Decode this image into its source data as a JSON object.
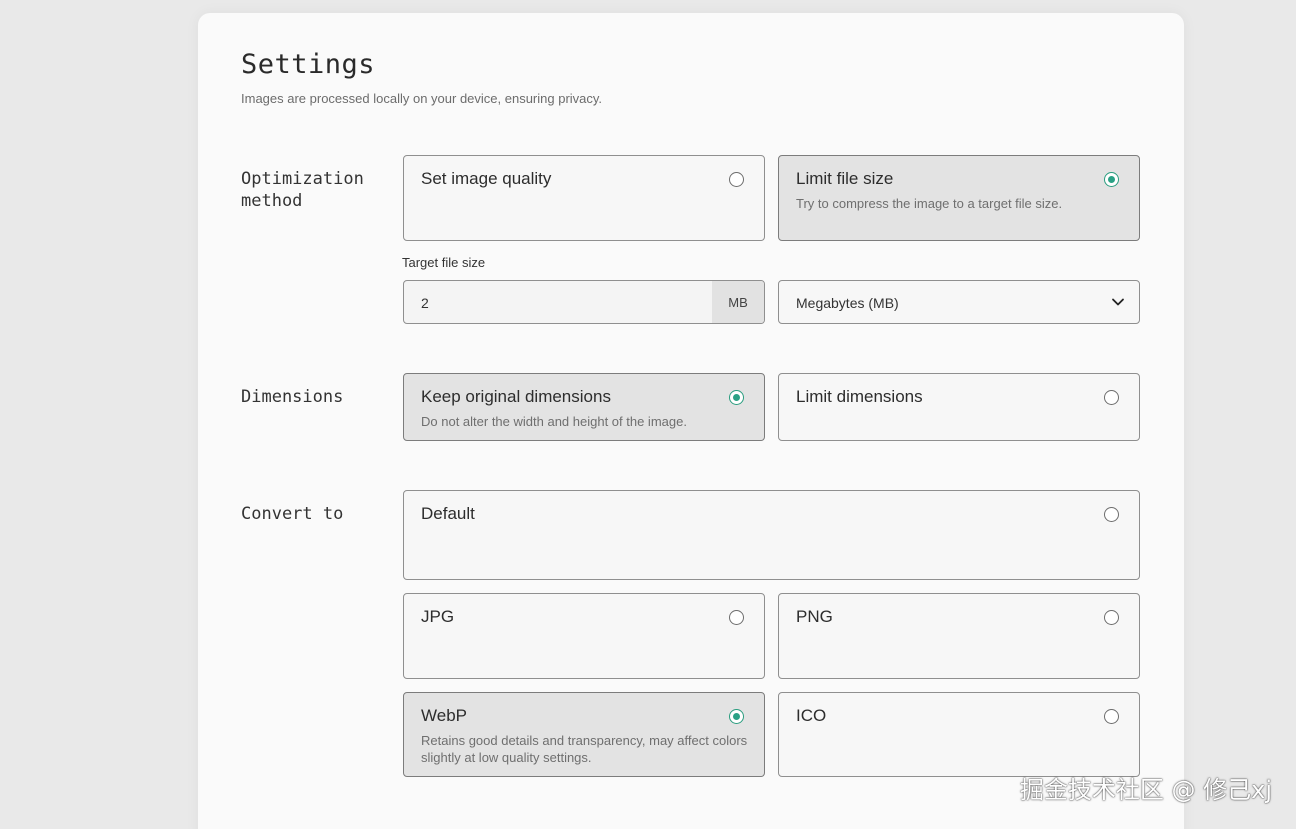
{
  "settings": {
    "title": "Settings",
    "subtitle": "Images are processed locally on your device, ensuring privacy."
  },
  "optimization": {
    "label": "Optimization method",
    "options": [
      {
        "title": "Set image quality",
        "description": "",
        "selected": false
      },
      {
        "title": "Limit file size",
        "description": "Try to compress the image to a target file size.",
        "selected": true
      }
    ],
    "target_label": "Target file size",
    "target_value": "2",
    "target_unit": "MB",
    "unit_select": "Megabytes (MB)"
  },
  "dimensions": {
    "label": "Dimensions",
    "options": [
      {
        "title": "Keep original dimensions",
        "description": "Do not alter the width and height of the image.",
        "selected": true
      },
      {
        "title": "Limit dimensions",
        "description": "",
        "selected": false
      }
    ]
  },
  "convert": {
    "label": "Convert to",
    "options": [
      {
        "title": "Default",
        "description": "",
        "selected": false
      },
      {
        "title": "JPG",
        "description": "",
        "selected": false
      },
      {
        "title": "PNG",
        "description": "",
        "selected": false
      },
      {
        "title": "WebP",
        "description": "Retains good details and transparency, may affect colors slightly at low quality settings.",
        "selected": true
      },
      {
        "title": "ICO",
        "description": "",
        "selected": false
      }
    ]
  },
  "watermark": "掘金技术社区 @ 修己xj",
  "colors": {
    "accent": "#2aa185",
    "selected_bg": "#e3e3e3",
    "card_bg": "#fafafa"
  }
}
